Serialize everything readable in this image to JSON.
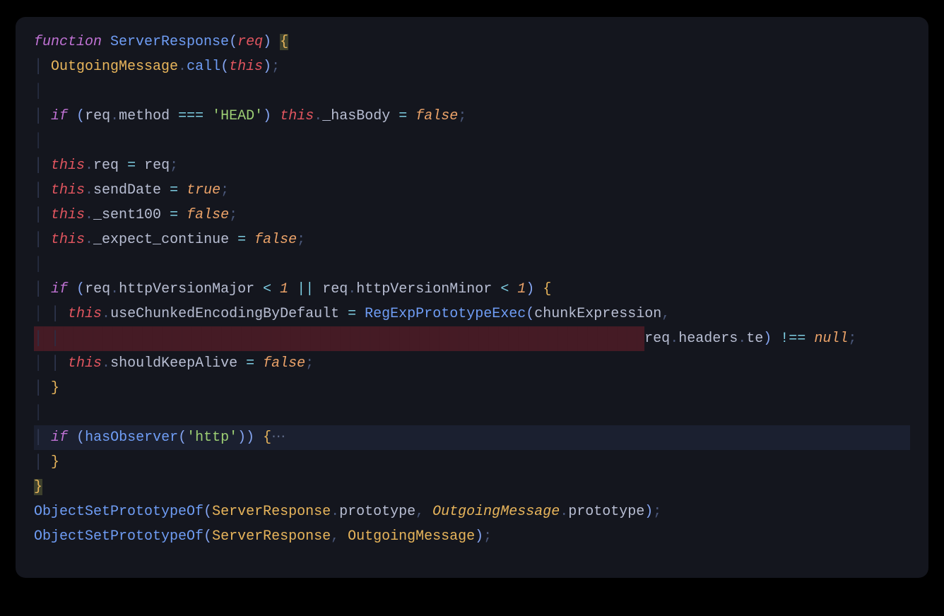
{
  "colors": {
    "background": "#000000",
    "editor_bg": "#14161e",
    "keyword": "#c072d4",
    "function": "#6f9df5",
    "param": "#e1555f",
    "punct": "#85a5f1",
    "dim": "#4a5779",
    "brace": "#e8b55b",
    "self": "#e1555f",
    "operator": "#7ecee3",
    "string": "#9dcf74",
    "boolean": "#eca369",
    "type": "#e8b55b",
    "text": "#b8bed3",
    "highlight_line": "#1b2030",
    "error_bg": "#451b25"
  },
  "code": {
    "kw_function": "function",
    "fn_ServerResponse": "ServerResponse",
    "param_req": "req",
    "ident_OutgoingMessage": "OutgoingMessage",
    "method_call": "call",
    "self": "this",
    "kw_if": "if",
    "ident_req": "req",
    "prop_method": "method",
    "op_eqeqeq": "===",
    "str_HEAD": "'HEAD'",
    "prop_hasBody": "_hasBody",
    "op_assign": "=",
    "bool_false": "false",
    "prop_req": "req",
    "prop_sendDate": "sendDate",
    "bool_true": "true",
    "prop_sent100": "_sent100",
    "prop_expect_continue": "_expect_continue",
    "prop_httpVersionMajor": "httpVersionMajor",
    "op_lt": "<",
    "num_1": "1",
    "op_or": "||",
    "prop_httpVersionMinor": "httpVersionMinor",
    "prop_useChunkedEncodingByDefault": "useChunkedEncodingByDefault",
    "fn_RegExpPrototypeExec": "RegExpPrototypeExec",
    "ident_chunkExpression": "chunkExpression",
    "prop_headers": "headers",
    "prop_te": "te",
    "op_neq": "!==",
    "bool_null": "null",
    "prop_shouldKeepAlive": "shouldKeepAlive",
    "fn_hasObserver": "hasObserver",
    "str_http": "'http'",
    "ellipsis": "⋯",
    "fn_ObjectSetPrototypeOf": "ObjectSetPrototypeOf",
    "prop_prototype": "prototype"
  }
}
